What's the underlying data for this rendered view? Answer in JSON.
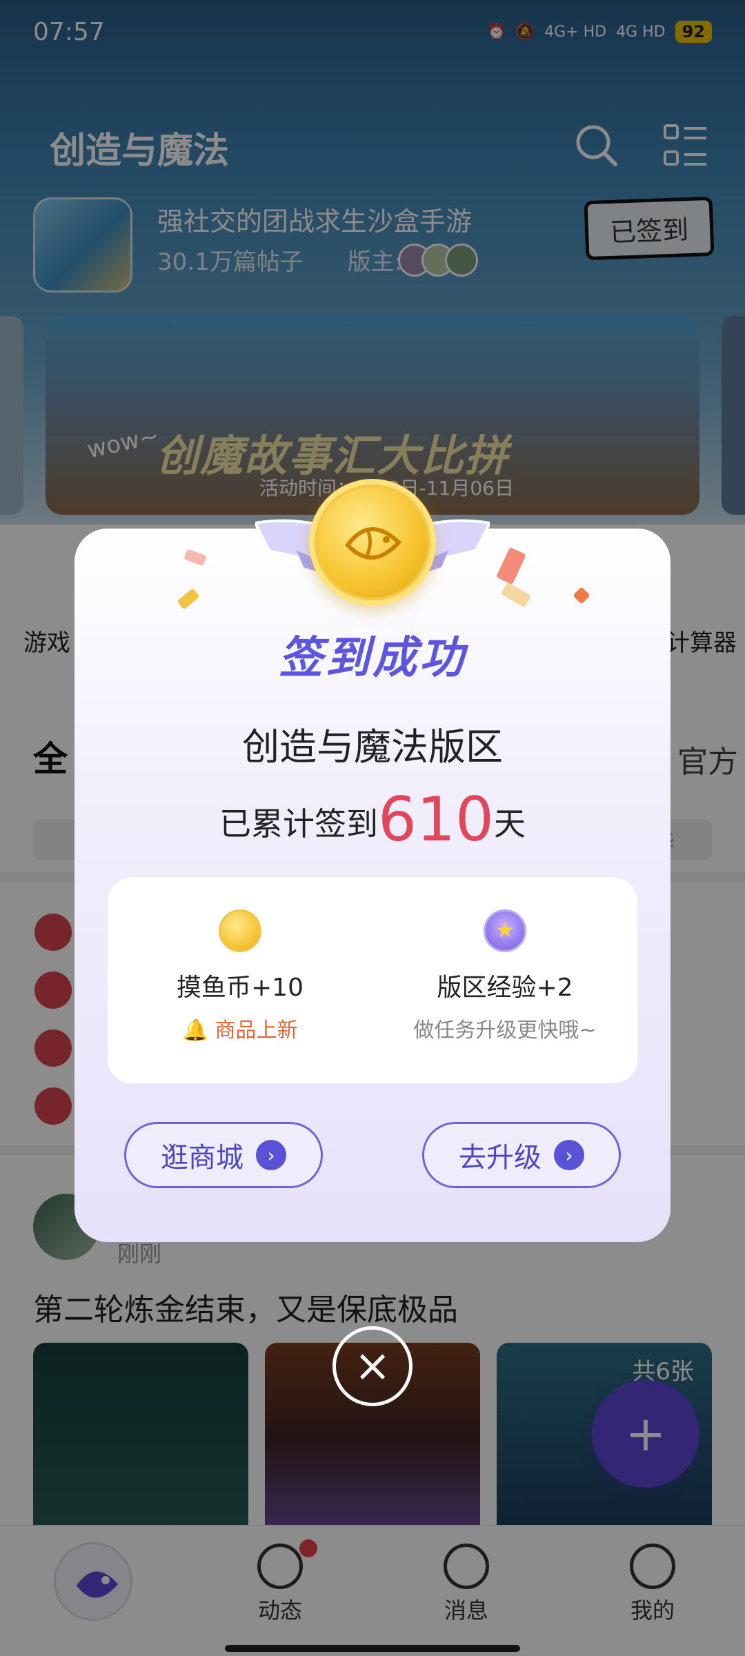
{
  "status_bar": {
    "time": "07:57",
    "network1": "4G+ HD",
    "network2": "4G HD",
    "battery": "92"
  },
  "header": {
    "title": "创造与魔法",
    "description": "强社交的团战求生沙盒手游",
    "post_count": "30.1万篇帖子",
    "moderator_label": "版主:",
    "signed_button": "已签到"
  },
  "banner": {
    "title": "创魔故事汇大比拼",
    "wow": "wow~",
    "time": "活动时间：…03日-11月06日"
  },
  "quick_entries": {
    "left_label": "游戏",
    "right_label": "计算器"
  },
  "tabs": {
    "first": "全",
    "last": "官方",
    "pill_right": "精华"
  },
  "post": {
    "time": "刚刚",
    "text": "第二轮炼金结束，又是保底极品",
    "image_count": "共6张"
  },
  "fab_label": "+",
  "bottom_nav": [
    {
      "label": ""
    },
    {
      "label": "动态"
    },
    {
      "label": "消息"
    },
    {
      "label": "我的"
    }
  ],
  "modal": {
    "title": "签到成功",
    "board_name": "创造与魔法版区",
    "streak_prefix": "已累计签到",
    "streak_days": "610",
    "streak_suffix": "天",
    "rewards": [
      {
        "icon": "fish-coin-icon",
        "title": "摸鱼币+10",
        "subtitle": "商品上新",
        "subtitle_color": "#e2683a"
      },
      {
        "icon": "level-badge-icon",
        "title": "版区经验+2",
        "subtitle": "做任务升级更快哦~",
        "subtitle_color": "#888888"
      }
    ],
    "buttons": {
      "shop": "逛商城",
      "upgrade": "去升级"
    },
    "close_icon": "×"
  },
  "colors": {
    "accent": "#5b55e0",
    "streak": "#e2465a",
    "fab": "#5b46d6"
  }
}
